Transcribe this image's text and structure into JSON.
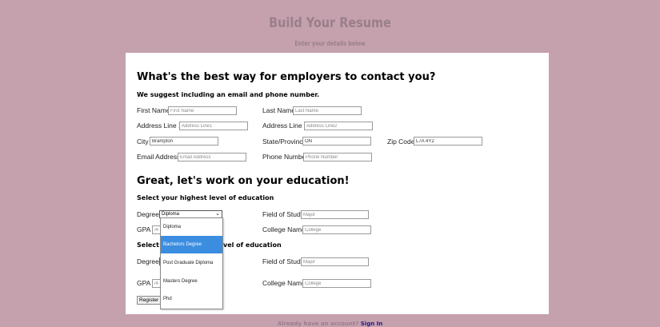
{
  "header": {
    "title": "Build Your Resume",
    "subtitle": "Enter your details below"
  },
  "contact": {
    "heading": "What's the best way for employers to contact you?",
    "subheading": "We suggest including an email and phone number.",
    "first_name_label": "First Name",
    "first_name_placeholder": "First Name",
    "last_name_label": "Last Name",
    "last_name_placeholder": "Last Name",
    "address1_label": "Address Line 1",
    "address1_placeholder": "Address Line1",
    "address2_label": "Address Line 2",
    "address2_placeholder": "Address Line2",
    "city_label": "City",
    "city_value": "Brampton",
    "state_label": "State/Province",
    "state_value": "ON",
    "zip_label": "Zip Code",
    "zip_value": "L7A 4Y2",
    "email_label": "Email Address",
    "email_placeholder": "Email Address",
    "phone_label": "Phone Number",
    "phone_placeholder": "Phone Number"
  },
  "education": {
    "heading": "Great, let's work on your education!",
    "highest_label": "Select your highest level of education",
    "second_label_visible": "vel of education",
    "second_label_prefix": "Select y",
    "degree_label": "Degree",
    "degree_selected": "Diploma",
    "field_label": "Field of Study",
    "field_placeholder": "Major",
    "gpa_label": "GPA",
    "gpa_placeholder": "/4",
    "college_label": "College Name",
    "college_placeholder": "College",
    "degree_options": [
      "Diploma",
      "Bachelors Degree",
      "Post Graduate Diploma",
      "Masters Degree",
      "Phd"
    ],
    "highlighted_option": "Bachelors Degree"
  },
  "register_button": "Register",
  "footer": {
    "text": "Already have an account?",
    "link": "Sign In"
  },
  "colors": {
    "background": "#c5a0ad",
    "highlight": "#3b8de0",
    "link": "#2a1a8a"
  }
}
